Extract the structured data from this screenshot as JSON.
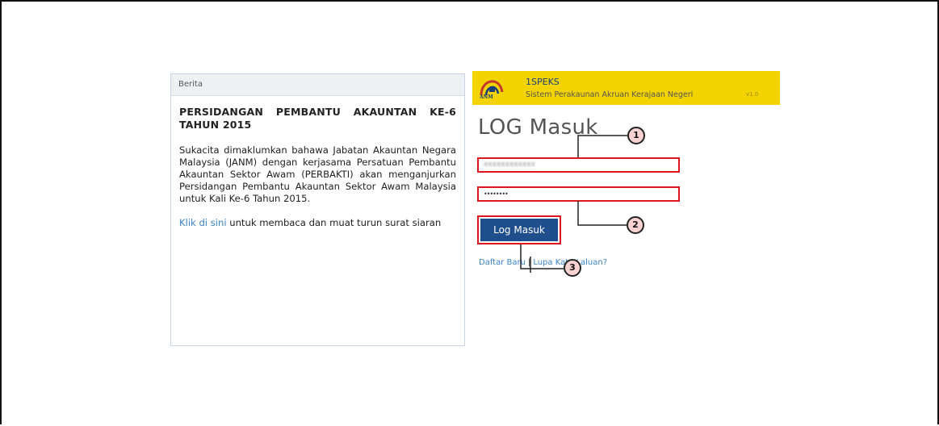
{
  "news": {
    "header": "Berita",
    "title": "PERSIDANGAN PEMBANTU AKAUNTAN KE-6 TAHUN 2015",
    "body": "Sukacita dimaklumkan bahawa Jabatan Akauntan Negara Malaysia (JANM) dengan kerjasama Persatuan Pembantu Akauntan Sektor Awam (PERBAKTI) akan menganjurkan Persidangan Pembantu Akauntan Sektor Awam Malaysia untuk Kali Ke-6 Tahun 2015.",
    "link_text": "Klik di sini",
    "link_suffix": " untuk membaca dan muat turun surat siaran"
  },
  "brand": {
    "logo_text": "ANM",
    "name": "1SPEKS",
    "subtitle": "Sistem Perakaunan Akruan Kerajaan Negeri",
    "version": "v1.0"
  },
  "login": {
    "title": "LOG Masuk",
    "username_value": "xxxxxxxxxxxx",
    "password_value": "••••••••",
    "button_label": "Log Masuk",
    "register_link": "Daftar Baru",
    "separator": "|",
    "forgot_link": "Lupa Kata Laluan?"
  },
  "callouts": [
    "1",
    "2",
    "3"
  ],
  "colors": {
    "brand_bg": "#f3d300",
    "button_bg": "#1f4e8c",
    "link": "#3a84c5",
    "highlight": "#e0141e",
    "callout_fill": "#fad2d2"
  }
}
